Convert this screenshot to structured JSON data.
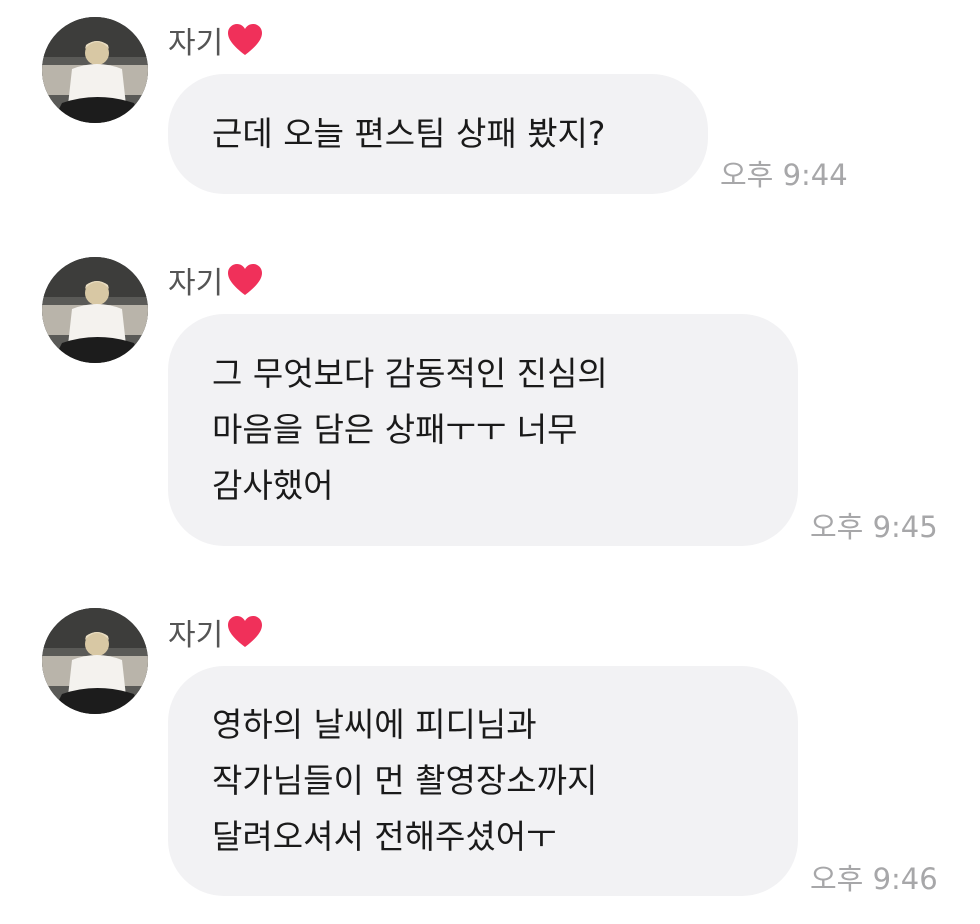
{
  "messages": [
    {
      "sender": "자기",
      "sender_icon": "heart-icon",
      "lines": [
        "근데 오늘 편스팀 상패 봤지?"
      ],
      "time": "오후 9:44"
    },
    {
      "sender": "자기",
      "sender_icon": "heart-icon",
      "lines": [
        "그 무엇보다 감동적인 진심의",
        "마음을 담은 상패ㅜㅜ 너무",
        "감사했어"
      ],
      "time": "오후 9:45"
    },
    {
      "sender": "자기",
      "sender_icon": "heart-icon",
      "lines": [
        "영하의 날씨에 피디님과",
        "작가님들이 먼 촬영장소까지",
        "달려오셔서 전해주셨어ㅜ"
      ],
      "time": "오후 9:46"
    }
  ],
  "colors": {
    "bubble": "#f2f2f4",
    "heart": "#f0305a",
    "time": "#a7a7a9"
  }
}
